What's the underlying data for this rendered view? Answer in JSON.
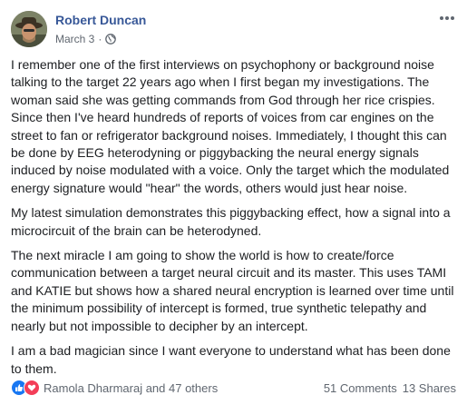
{
  "post": {
    "author": "Robert Duncan",
    "date": "March 3",
    "privacy_icon": "globe-icon",
    "paragraphs": [
      "I remember one of the first interviews on psychophony or background noise talking to the target 22 years ago when I first began my investigations. The woman said she was getting commands from God through her rice crispies. Since then I've heard hundreds of reports of voices from car engines on the street to fan or refrigerator background noises. Immediately, I thought this can be done by EEG heterodyning or piggybacking the neural energy signals induced by noise modulated with a voice. Only the target which the modulated energy signature would \"hear\" the words, others would just hear noise.",
      "My latest simulation demonstrates this piggybacking effect, how a signal into a microcircuit of the brain can be heterodyned.",
      "The next miracle I am going to show the world is how to create/force communication between a target neural circuit and its master. This uses TAMI and KATIE but shows how a shared neural encryption is learned over time until the minimum possibility of intercept is formed, true synthetic telepathy and nearly but not impossible to decipher by an intercept.",
      "I am a bad magician since I want everyone to understand what has been done to them."
    ]
  },
  "footer": {
    "reactors": "Ramola Dharmaraj and 47 others",
    "comments": "51 Comments",
    "shares": "13 Shares"
  },
  "colors": {
    "author_link": "#385898",
    "meta_text": "#606770",
    "like": "#1877f2",
    "love": "#f33e58"
  }
}
